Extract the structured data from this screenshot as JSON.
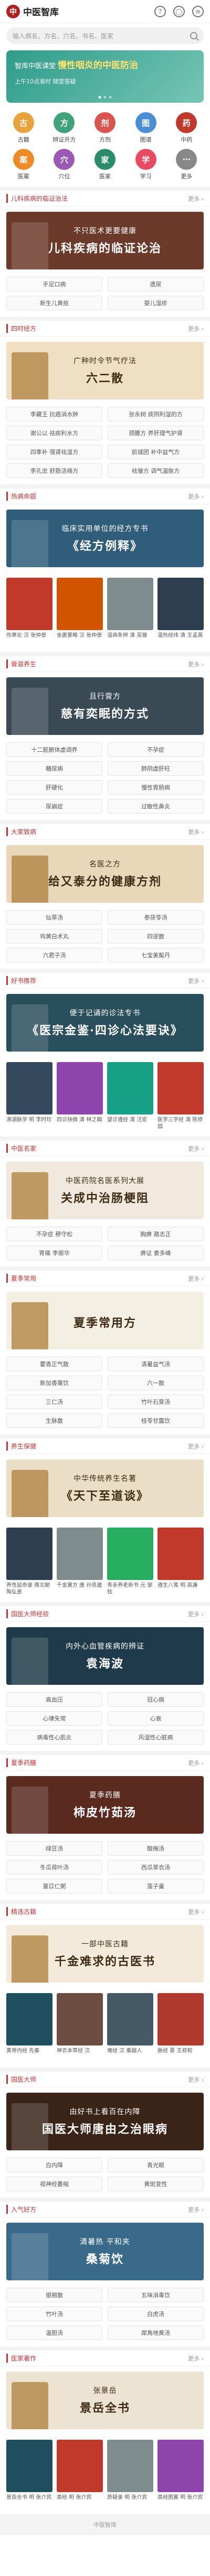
{
  "header": {
    "logo_char": "中",
    "app_name": "中医智库"
  },
  "search": {
    "placeholder": "输入病名、方名、穴名、书名、医家"
  },
  "banner": {
    "line1": "智库中医课堂",
    "highlight": "慢性咽炎的中医防治",
    "line2": "上午10点准时 随堂答疑"
  },
  "icons": [
    {
      "label": "古籍",
      "glyph": "古",
      "color": "#e8a33c"
    },
    {
      "label": "辨证开方",
      "glyph": "方",
      "color": "#3fa27a"
    },
    {
      "label": "方剂",
      "glyph": "剂",
      "color": "#d9534f"
    },
    {
      "label": "图谱",
      "glyph": "图",
      "color": "#4a8fd6"
    },
    {
      "label": "中药",
      "glyph": "药",
      "color": "#c0392b"
    },
    {
      "label": "医案",
      "glyph": "案",
      "color": "#f08a24"
    },
    {
      "label": "穴位",
      "glyph": "穴",
      "color": "#9b59b6"
    },
    {
      "label": "医家",
      "glyph": "家",
      "color": "#2b8c6b"
    },
    {
      "label": "学习",
      "glyph": "学",
      "color": "#e84a5f"
    },
    {
      "label": "更多",
      "glyph": "⋯",
      "color": "#888888"
    }
  ],
  "more_label": "更多 ›",
  "sections": [
    {
      "title": "儿科疾病的临证治法",
      "hero": {
        "line1": "不只医术更要健康",
        "line2": "儿科疾病的临证论治",
        "bg": "#6b3a2a",
        "dark": false
      },
      "tags": [
        "手足口病",
        "遗尿",
        "新生儿黄疸",
        "婴儿湿疹"
      ]
    },
    {
      "title": "四时经方",
      "hero": {
        "line1": "广种时令节气疗法",
        "line2": "六二散",
        "bg": "#efe0c4",
        "dark": true
      },
      "tags": [
        "李藏王 抗癌消水肿",
        "张永树 痰阴利湿的方",
        "谢公以 祛痰利水方",
        "颈腰方 养肝理气护肾",
        "四季补 强肾祛湿方",
        "前城团 补中益气方",
        "李孔忠 舒筋活络方",
        "祛皱方 调气温肤方"
      ]
    },
    {
      "title": "热病命题",
      "hero": {
        "line1": "临床实用单位的经方专书",
        "line2": "《经方例释》",
        "bg": "#2f5d7a",
        "dark": false
      },
      "books": [
        {
          "name": "伤寒论 汉 张仲景",
          "color": "#c0392b"
        },
        {
          "name": "金匮要略 汉 张仲景",
          "color": "#d35400"
        },
        {
          "name": "温病条辨 清 吴瑭",
          "color": "#7f8c8d"
        },
        {
          "name": "温热经纬 清 王孟英",
          "color": "#2c3e50"
        }
      ]
    },
    {
      "title": "膏滋养生",
      "hero": {
        "line1": "且行膏方",
        "line2": "慈有奕眠的方式",
        "bg": "#3a4a55",
        "dark": false
      },
      "tags": [
        "十二脏腑体虚调养",
        "不孕症",
        "糖尿病",
        "肺阴虚肝旺",
        "肝硬化",
        "慢性胃肠病",
        "尿崩症",
        "过敏性鼻炎"
      ]
    },
    {
      "title": "大家致病",
      "hero": {
        "line1": "名医之方",
        "line2": "给又泰分的健康方剂",
        "bg": "#e8d7b8",
        "dark": true
      },
      "tags": [
        "仙草汤",
        "参茯苓汤",
        "鸡黄白术丸",
        "四逆散",
        "六君子汤",
        "七宝美髯丹"
      ]
    },
    {
      "title": "好书推荐",
      "hero": {
        "line1": "便于记诵的诊法专书",
        "line2": "《医宗金鉴·四诊心法要诀》",
        "bg": "#2a4f5c",
        "dark": false
      },
      "books": [
        {
          "name": "濒湖脉学 明 李时珍",
          "color": "#34495e"
        },
        {
          "name": "四诊抉微 清 林之翰",
          "color": "#8e44ad"
        },
        {
          "name": "望诊遵经 清 汪宏",
          "color": "#16a085"
        },
        {
          "name": "医学三字经 清 陈修园",
          "color": "#c0392b"
        }
      ]
    },
    {
      "title": "中医名家",
      "hero": {
        "line1": "中医药院名医系列大展",
        "line2": "关成中治肠梗阻",
        "bg": "#f1e9dd",
        "dark": true
      },
      "tags": [
        "不孕症 穆守松",
        "胸痹 路志正",
        "胃痛 李振华",
        "痹证 娄多峰"
      ]
    },
    {
      "title": "夏季常用",
      "hero": {
        "line1": "",
        "line2": "夏季常用方",
        "bg": "#f4efe3",
        "dark": true
      },
      "tags": [
        "藿香正气散",
        "清暑益气汤",
        "新加香薷饮",
        "六一散",
        "三仁汤",
        "竹叶石膏汤",
        "生脉散",
        "桂苓甘露饮"
      ]
    },
    {
      "title": "养生保健",
      "hero": {
        "line1": "中华传统养生名著",
        "line2": "《天下至道谈》",
        "bg": "#eadfc6",
        "dark": true
      },
      "books": [
        {
          "name": "养性延命录 南北朝 陶弘景",
          "color": "#2c3e50"
        },
        {
          "name": "千金翼方 唐 孙思邈",
          "color": "#7f8c8d"
        },
        {
          "name": "寿亲养老新书 元 邹铉",
          "color": "#27ae60"
        },
        {
          "name": "遵生八笺 明 高濂",
          "color": "#c0392b"
        }
      ]
    },
    {
      "title": "国医大师经验",
      "hero": {
        "line1": "内外心血管疾病的辨证",
        "line2": "袁海波",
        "bg": "#1f3a4a",
        "dark": false
      },
      "tags": [
        "高血压",
        "冠心病",
        "心律失常",
        "心衰",
        "病毒性心肌炎",
        "风湿性心脏病"
      ]
    },
    {
      "title": "夏季药膳",
      "hero": {
        "line1": "夏季药膳",
        "line2": "柿皮竹茹汤",
        "bg": "#5a2a1f",
        "dark": false
      },
      "tags": [
        "绿豆汤",
        "酸梅汤",
        "冬瓜荷叶汤",
        "西瓜翠衣汤",
        "薏苡仁粥",
        "莲子羹"
      ]
    },
    {
      "title": "精选古籍",
      "hero": {
        "line1": "一部中医古籍",
        "line2": "千金难求的古医书",
        "bg": "#f3eadb",
        "dark": true
      },
      "books": [
        {
          "name": "黄帝内经 先秦",
          "color": "#1f4e5f"
        },
        {
          "name": "神农本草经 汉",
          "color": "#6d4c41"
        },
        {
          "name": "难经 汉 秦越人",
          "color": "#455a64"
        },
        {
          "name": "脉经 晋 王叔和",
          "color": "#b03a2e"
        }
      ]
    },
    {
      "title": "国医大师",
      "hero": {
        "line1": "由好书上看百在内障",
        "line2": "国医大师唐由之治眼病",
        "bg": "#3a2418",
        "dark": false
      },
      "tags": [
        "白内障",
        "青光眼",
        "视神经萎缩",
        "黄斑变性"
      ]
    },
    {
      "title": "入气好方",
      "hero": {
        "line1": "清暑热 平和夹",
        "line2": "桑菊饮",
        "bg": "#3a6a8a",
        "dark": false
      },
      "tags": [
        "银翘散",
        "五味消毒饮",
        "竹叶汤",
        "白虎汤",
        "温胆汤",
        "犀角地黄汤"
      ]
    },
    {
      "title": "医家著作",
      "hero": {
        "line1": "张景岳",
        "line2": "景岳全书",
        "bg": "#ece3d3",
        "dark": true
      },
      "books": [
        {
          "name": "景岳全书 明 张介宾",
          "color": "#1f4e5f"
        },
        {
          "name": "类经 明 张介宾",
          "color": "#c0392b"
        },
        {
          "name": "质疑录 明 张介宾",
          "color": "#7f8c8d"
        },
        {
          "name": "类经图翼 明 张介宾",
          "color": "#8e44ad"
        }
      ]
    }
  ],
  "footer": {
    "text": "中医智库"
  }
}
